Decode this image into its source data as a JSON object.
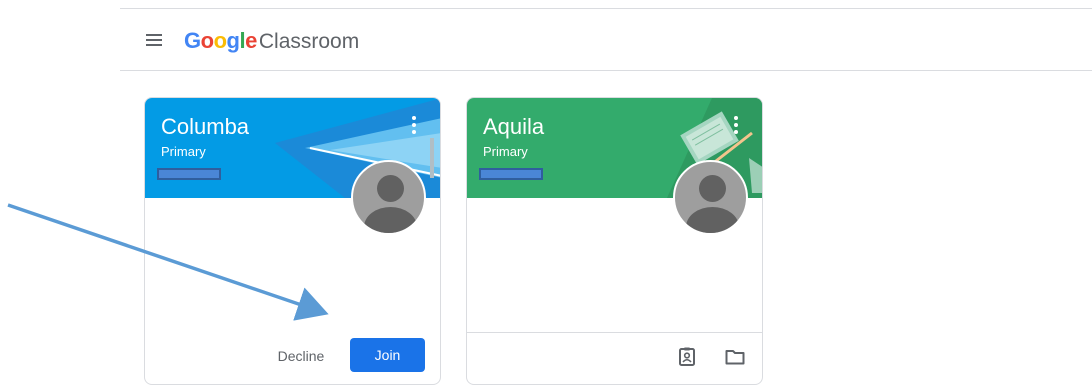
{
  "header": {
    "logo_google_letters": [
      "G",
      "o",
      "o",
      "g",
      "l",
      "e"
    ],
    "logo_google_colors": [
      "#4285F4",
      "#EA4335",
      "#FBBC05",
      "#4285F4",
      "#34A853",
      "#EA4335"
    ],
    "logo_product": "Classroom",
    "menu_icon": "hamburger-menu-icon"
  },
  "classes": [
    {
      "title": "Columba",
      "section": "Primary",
      "banner_color": "#039be5",
      "invite": true,
      "decline_label": "Decline",
      "join_label": "Join"
    },
    {
      "title": "Aquila",
      "section": "Primary",
      "banner_color": "#33ab6c",
      "invite": false,
      "footer_icons": [
        "assignment-icon",
        "folder-icon"
      ]
    }
  ],
  "colors": {
    "join_button": "#1a73e8",
    "annotation_arrow": "#5b9bd5",
    "divider": "#dadce0"
  }
}
